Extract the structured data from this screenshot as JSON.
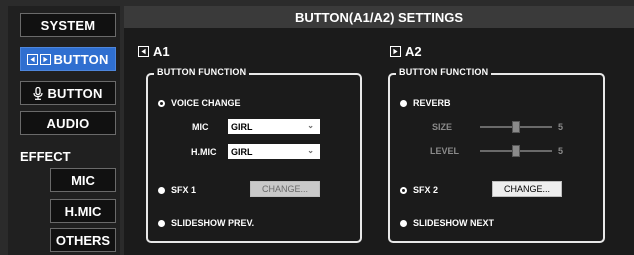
{
  "sidebar": {
    "system": "SYSTEM",
    "button_ab": "BUTTON",
    "button_mic": "BUTTON",
    "audio": "AUDIO",
    "effect_label": "EFFECT",
    "mic": "MIC",
    "hmic": "H.MIC",
    "others": "OTHERS",
    "active_color": "#2f6fd0"
  },
  "main": {
    "title": "BUTTON(A1/A2) SETTINGS",
    "a1": {
      "heading": "A1",
      "group_title": "BUTTON FUNCTION",
      "voice_change": "VOICE CHANGE",
      "mic_label": "MIC",
      "mic_value": "GIRL",
      "hmic_label": "H.MIC",
      "hmic_value": "GIRL",
      "sfx1": "SFX 1",
      "change_label": "CHANGE...",
      "slideshow_prev": "SLIDESHOW PREV.",
      "selected": "VOICE CHANGE"
    },
    "a2": {
      "heading": "A2",
      "group_title": "BUTTON FUNCTION",
      "reverb": "REVERB",
      "size_label": "SIZE",
      "size_value": "5",
      "size_level": 0.5,
      "level_label": "LEVEL",
      "level_value": "5",
      "level_level": 0.5,
      "sfx2": "SFX 2",
      "change_label": "CHANGE...",
      "slideshow_next": "SLIDESHOW NEXT",
      "selected": "SFX 2"
    }
  }
}
